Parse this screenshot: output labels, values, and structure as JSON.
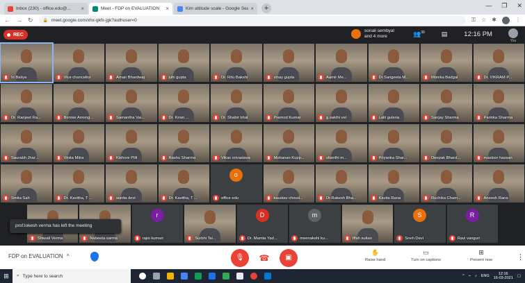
{
  "browser": {
    "tabs": [
      {
        "label": "Inbox (230) - office.edu@...",
        "color": "#ea4335",
        "active": false
      },
      {
        "label": "Meet - FDP on EVALUATION",
        "color": "#00897b",
        "active": true
      },
      {
        "label": "Kim attitude scale - Google Sea...",
        "color": "#4285f4",
        "active": false
      }
    ],
    "new_tab": "+",
    "url": "meet.google.com/xhx-gkfx-jgk?authuser=0"
  },
  "meet_top": {
    "rec_label": "REC",
    "presenter_line1": "sonali sembyal",
    "presenter_line2": "and 4 more",
    "people_count": "39",
    "clock": "12:16 PM",
    "you_label": "You"
  },
  "participants": [
    [
      "Iri Baliya",
      "Vice chancellor",
      "Aman Bhardwaj",
      "juhi gupta",
      "Dr. Ritu Bakshi",
      "vinay gupta",
      "Aamir Me...",
      "Dr.Sangeeta M...",
      "Monika Badgal",
      "Dr. VIKRAM P..."
    ],
    [
      "Dr. Ranjeet Ra...",
      "Bonnie Among...",
      "Samantha Vai...",
      "Dr. Kiran ...",
      "Dr. Shabir bhat",
      "Pramod Kumar",
      "g.sakthi vel",
      "Lalit guleria",
      "Sanjay Sharma",
      "Parinka Sharma"
    ],
    [
      "Saurabh Jhar...",
      "Vinita Mitra",
      "Kishore Pilli",
      "Rashu Sharma",
      "Vikas srivastava",
      "Mohanan Kupp...",
      "shanthi m...",
      "Priyanka Shar...",
      "Deepak Bhard...",
      "mastoor hassan"
    ],
    [
      "Smita Sah",
      "Dr. Kavitha, T ...",
      "sunita devi",
      "Dr. Kavitha, T ...",
      "office edu",
      "kaustav choud...",
      "Dr.Rakesh Bha...",
      "Kavita Rana",
      "Ruchika Cham...",
      "Aneesh Rana"
    ],
    [
      "Shiwali Verma",
      "Nabeeta sarma",
      "rajni kumari",
      "Surbhi Tai...",
      "Dr. Mamta Yad...",
      "meenakshi ku...",
      "Iffah sultan",
      "Sneh Devi",
      "Ravi vanguri"
    ]
  ],
  "avatar_letters": {
    "office edu": "o",
    "rajni kumari": "r",
    "Dr. Mamta Yad...": "D",
    "meenakshi ku...": "m",
    "Sneh Devi": "S",
    "Ravi vanguri": "R"
  },
  "toast": "prof.lokesh verma has left the meeting",
  "bottom": {
    "meeting_name": "FDP on EVALUATION",
    "caret": "^",
    "raise_hand": "Raise hand",
    "captions": "Turn on captions",
    "present": "Present now",
    "more": "⋮"
  },
  "taskbar": {
    "search_placeholder": "Type here to search",
    "lang": "ENG",
    "time": "12:16",
    "date": "16-03-2021"
  }
}
